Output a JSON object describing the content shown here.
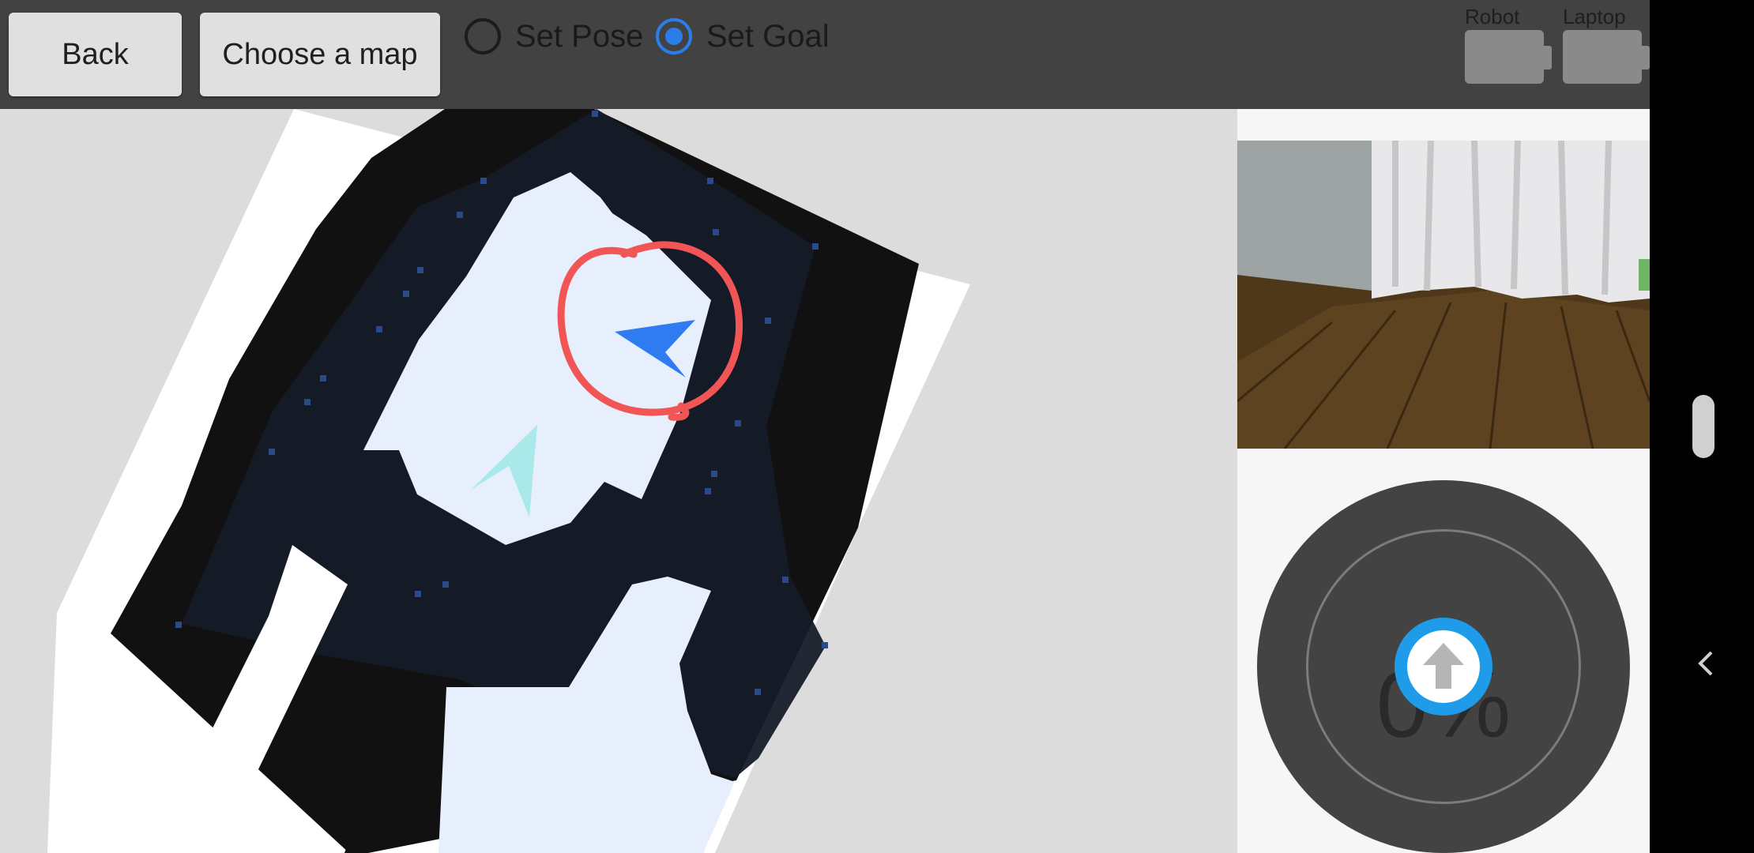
{
  "toolbar": {
    "back_label": "Back",
    "choose_map_label": "Choose a map",
    "modes": [
      {
        "label": "Set Pose",
        "checked": false
      },
      {
        "label": "Set Goal",
        "checked": true
      }
    ]
  },
  "battery": {
    "robot_label": "Robot",
    "laptop_label": "Laptop"
  },
  "joystick": {
    "speed_text": "0%"
  },
  "colors": {
    "accent": "#2b7de9",
    "toolbar_bg": "#424242",
    "goal_arrow": "#2f7cf2",
    "pose_arrow": "#a9e9e9",
    "annotation": "#f25555",
    "joystick_knob": "#1e9be9"
  },
  "icons": {
    "goal_marker": "navigation-arrow-icon",
    "robot_pose": "navigation-arrow-icon",
    "joystick_center": "arrow-up-icon",
    "system_back": "chevron-left-icon"
  }
}
